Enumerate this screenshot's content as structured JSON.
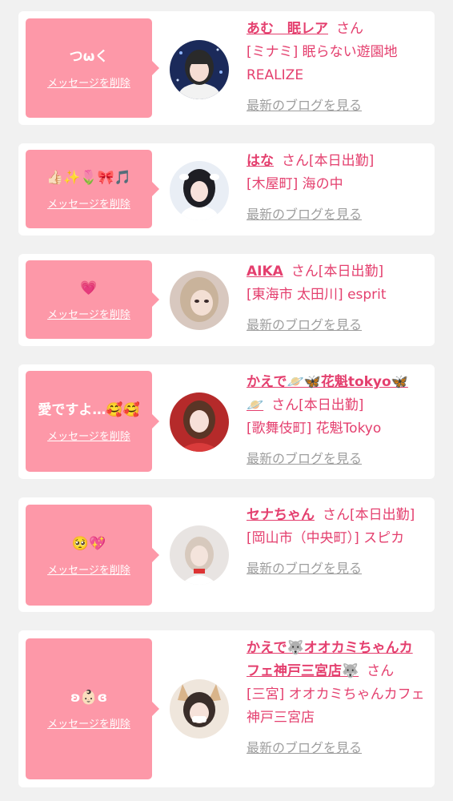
{
  "delete_label": "メッセージを削除",
  "blog_label": "最新のブログを見る",
  "san_label": "さん",
  "colors": {
    "bubble": "#fd98a8",
    "accent": "#e43f6e",
    "muted": "#9e9e9e",
    "background": "#f1f1f1"
  },
  "cards": [
    {
      "message": "つωく",
      "name": "あむ　眠レア",
      "san_text": "さん",
      "shop": "[ミナミ] 眠らない遊園地REALIZE"
    },
    {
      "message": "👍🏻✨🌷🎀🎵",
      "name": "はな",
      "san_text": "さん[本日出勤]",
      "shop": "[木屋町] 海の中"
    },
    {
      "message": "💗",
      "name": "AIKA",
      "san_text": "さん[本日出勤]",
      "shop": "[東海市 太田川] esprit"
    },
    {
      "message": "愛ですよ…🥰🥰",
      "name": "かえで🪐🦋花魁tokyo🦋🪐",
      "san_text": "さん[本日出勤]",
      "shop": "[歌舞伎町] 花魁Tokyo"
    },
    {
      "message": "🥺💖",
      "name": "セナちゃん",
      "san_text": "さん[本日出勤]",
      "shop": "[岡山市（中央町）] スピカ"
    },
    {
      "message": "ʚ👶🏻ɞ",
      "name": "かえで🐺オオカミちゃんカフェ神戸三宮店🐺",
      "san_text": "さん",
      "shop": "[三宮] オオカミちゃんカフェ神戸三宮店"
    }
  ]
}
